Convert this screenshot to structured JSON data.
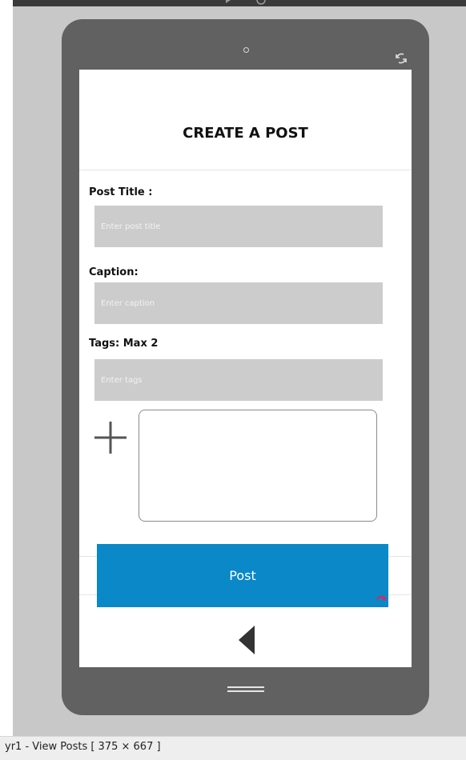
{
  "screen": {
    "title": "CREATE A POST"
  },
  "form": {
    "post_title_label": "Post Title :",
    "post_title_placeholder": "Enter post title",
    "caption_label": "Caption:",
    "caption_placeholder": "Enter caption",
    "tags_label": "Tags: Max 2",
    "tags_placeholder": "Enter tags",
    "post_button_label": "Post"
  },
  "status_bar": {
    "text": "yr1 - View Posts [ 375 × 667 ]"
  },
  "icons": {
    "add": "plus-icon",
    "back": "back-triangle-icon",
    "menu": "menu-lines-icon",
    "rotate": "rotate-icon",
    "camera": "camera-dot-icon",
    "hotspot": "hotspot-arrow-icon"
  },
  "colors": {
    "device": "#616161",
    "button": "#0a88c8",
    "input": "#cccccc"
  }
}
